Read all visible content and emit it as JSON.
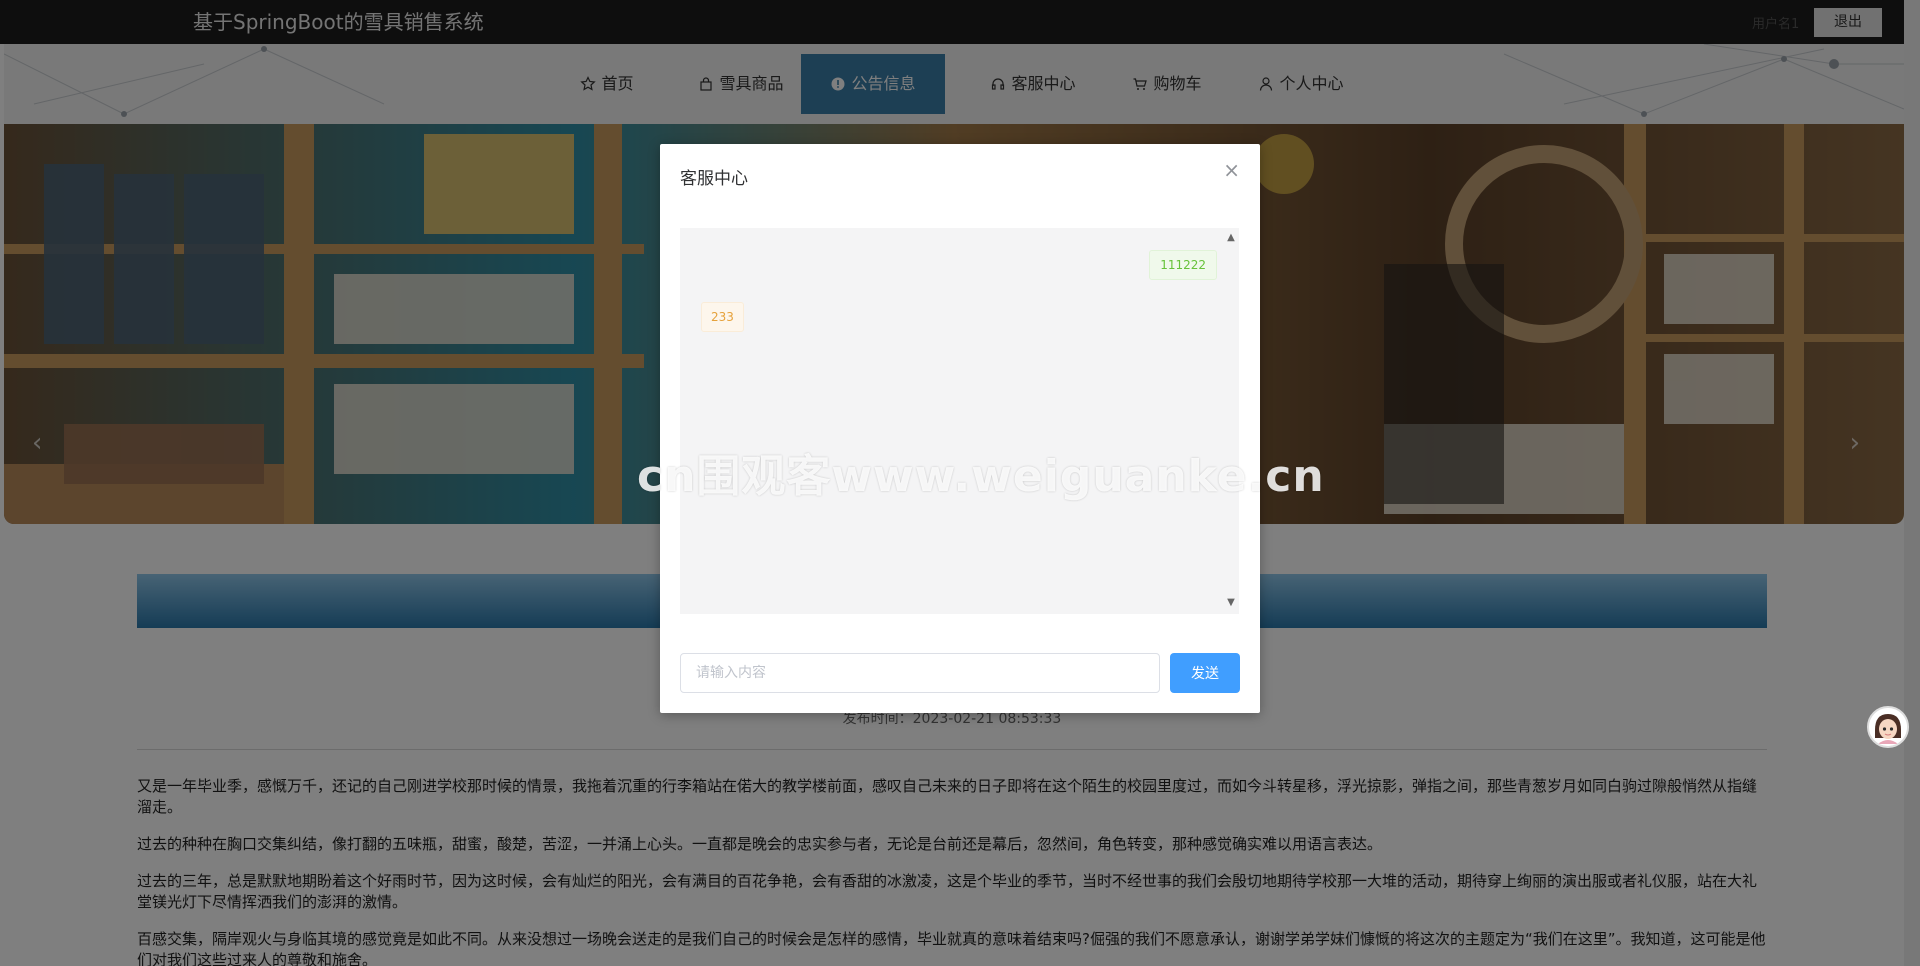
{
  "header": {
    "site_title": "基于SpringBoot的雪具销售系统",
    "user_name": "用户名1",
    "logout_label": "退出"
  },
  "nav": {
    "items": [
      {
        "label": "首页",
        "icon": "star-icon"
      },
      {
        "label": "雪具商品",
        "icon": "bag-icon"
      },
      {
        "label": "公告信息",
        "icon": "info-icon",
        "active": true
      },
      {
        "label": "客服中心",
        "icon": "headset-icon"
      },
      {
        "label": "购物车",
        "icon": "cart-icon"
      },
      {
        "label": "个人中心",
        "icon": "user-icon"
      }
    ]
  },
  "banner": {
    "prev_icon": "chevron-left-icon",
    "next_icon": "chevron-right-icon"
  },
  "notice": {
    "publish_time": "发布时间：2023-02-21 08:53:33",
    "paragraphs": [
      "又是一年毕业季，感慨万千，还记的自己刚进学校那时候的情景，我拖着沉重的行李箱站在偌大的教学楼前面，感叹自己未来的日子即将在这个陌生的校园里度过，而如今斗转星移，浮光掠影，弹指之间，那些青葱岁月如同白驹过隙般悄然从指缝溜走。",
      "过去的种种在胸口交集纠结，像打翻的五味瓶，甜蜜，酸楚，苦涩，一并涌上心头。一直都是晚会的忠实参与者，无论是台前还是幕后，忽然间，角色转变，那种感觉确实难以用语言表达。",
      "过去的三年，总是默默地期盼着这个好雨时节，因为这时候，会有灿烂的阳光，会有满目的百花争艳，会有香甜的冰激凌，这是个毕业的季节，当时不经世事的我们会殷切地期待学校那一大堆的活动，期待穿上绚丽的演出服或者礼仪服，站在大礼堂镁光灯下尽情挥洒我们的澎湃的激情。",
      "百感交集，隔岸观火与身临其境的感觉竟是如此不同。从来没想过一场晚会送走的是我们自己的时候会是怎样的感情，毕业就真的意味着结束吗?倔强的我们不愿意承认，谢谢学弟学妹们慷慨的将这次的主题定为“我们在这里”。我知道，这可能是他们对我们这些过来人的尊敬和施舍。"
    ]
  },
  "dialog": {
    "title": "客服中心",
    "close_icon": "close-icon",
    "messages": [
      {
        "side": "right",
        "text": "111222"
      },
      {
        "side": "left",
        "text": "233"
      }
    ],
    "input_placeholder": "请输入内容",
    "send_label": "发送"
  },
  "watermark": "cn围观客www.weiguanke.cn",
  "colors": {
    "topbar": "#1c1c1c",
    "nav_active": "#3b7fa8",
    "send_button": "#409eff",
    "msg_right_text": "#67c23a",
    "msg_left_text": "#e6a23c"
  }
}
